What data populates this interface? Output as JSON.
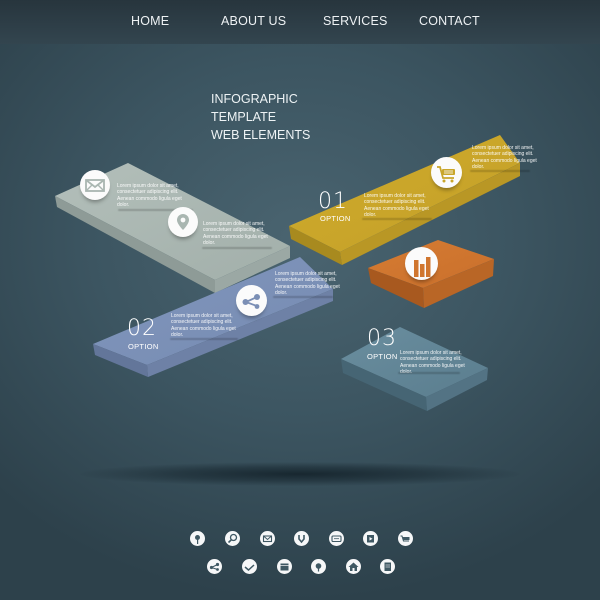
{
  "nav": {
    "items": [
      {
        "label": "HOME"
      },
      {
        "label": "ABOUT US"
      },
      {
        "label": "SERVICES"
      },
      {
        "label": "CONTACT"
      }
    ]
  },
  "headline": {
    "lines": [
      "INFOGRAPHIC",
      "TEMPLATE",
      "WEB ELEMENTS"
    ]
  },
  "colors": {
    "background": "#3f5863",
    "slab_gray": "#a9b6b1",
    "slab_yellow": "#c9a62b",
    "slab_blue": "#7b8fb5",
    "slab_orange": "#d0762f",
    "slab_teal": "#5e8293"
  },
  "options": [
    {
      "number": "01",
      "label": "OPTION"
    },
    {
      "number": "02",
      "label": "OPTION"
    },
    {
      "number": "03",
      "label": "OPTION"
    }
  ],
  "lorem": "Lorem ipsum dolor sit amet, consectetuer adipiscing elit. Aenean commodo ligula eget dolor.",
  "blocks": {
    "gray": {
      "icons": [
        "mail-icon",
        "location-pin-icon"
      ]
    },
    "yellow": {
      "icons": [
        "shopping-cart-icon"
      ]
    },
    "blue": {
      "icons": [
        "share-icon"
      ]
    },
    "orange": {
      "icons": [
        "bar-chart-icon"
      ]
    }
  },
  "icon_row_1": [
    "user-icon",
    "search-icon",
    "mail-icon",
    "download-icon",
    "message-icon",
    "video-icon",
    "shopping-cart-icon"
  ],
  "icon_row_2": [
    "share-icon",
    "check-icon",
    "calendar-icon",
    "location-pin-icon",
    "home-icon",
    "document-icon"
  ]
}
